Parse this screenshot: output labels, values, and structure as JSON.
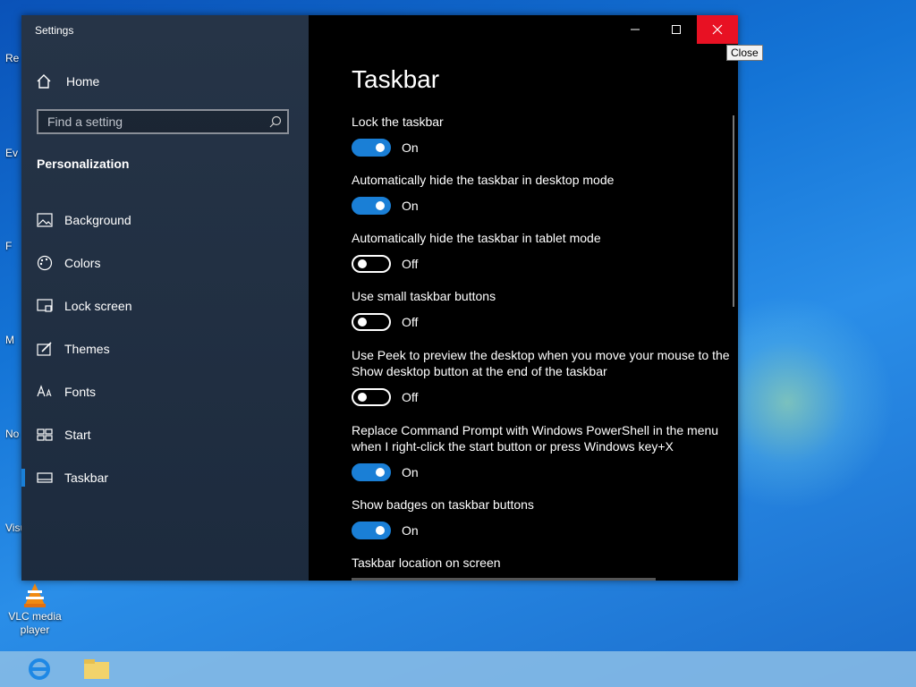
{
  "desktop": {
    "icons": [
      {
        "id": "vlc",
        "label": "VLC media player"
      }
    ],
    "stubs": [
      "Re",
      "Ev",
      "F",
      "M",
      "No",
      "Visu"
    ]
  },
  "window": {
    "title": "Settings",
    "close_tooltip": "Close"
  },
  "sidebar": {
    "home_label": "Home",
    "search_placeholder": "Find a setting",
    "section": "Personalization",
    "items": [
      {
        "label": "Background",
        "icon": "image-icon"
      },
      {
        "label": "Colors",
        "icon": "palette-icon"
      },
      {
        "label": "Lock screen",
        "icon": "lock-screen-icon"
      },
      {
        "label": "Themes",
        "icon": "themes-icon"
      },
      {
        "label": "Fonts",
        "icon": "fonts-icon"
      },
      {
        "label": "Start",
        "icon": "start-icon"
      },
      {
        "label": "Taskbar",
        "icon": "taskbar-icon",
        "active": true
      }
    ]
  },
  "content": {
    "title": "Taskbar",
    "settings": [
      {
        "label": "Lock the taskbar",
        "state": "On"
      },
      {
        "label": "Automatically hide the taskbar in desktop mode",
        "state": "On"
      },
      {
        "label": "Automatically hide the taskbar in tablet mode",
        "state": "Off"
      },
      {
        "label": "Use small taskbar buttons",
        "state": "Off"
      },
      {
        "label": "Use Peek to preview the desktop when you move your mouse to the Show desktop button at the end of the taskbar",
        "state": "Off"
      },
      {
        "label": "Replace Command Prompt with Windows PowerShell in the menu when I right-click the start button or press Windows key+X",
        "state": "On"
      },
      {
        "label": "Show badges on taskbar buttons",
        "state": "On"
      }
    ],
    "location_label": "Taskbar location on screen"
  },
  "colors": {
    "accent": "#1a7fd6",
    "close": "#e81123"
  }
}
